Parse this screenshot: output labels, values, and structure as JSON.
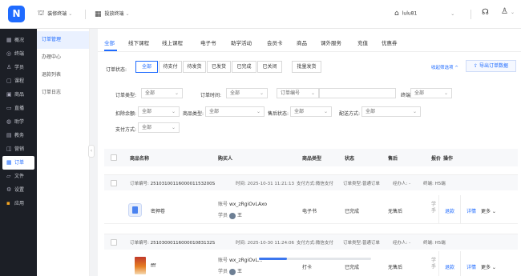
{
  "topbar": {
    "logo_letter": "N",
    "terminal_label": "装修终端",
    "terminal_icon": "shirt-icon",
    "admin_label": "投放终端",
    "admin_icon": "grid-icon",
    "shop_label": "lulu81",
    "shop_icon": "bank-icon",
    "help_icon": "headset-icon",
    "user_icon": "user-icon"
  },
  "sidebar": {
    "items": [
      {
        "icon": "grid-icon",
        "glyph": "▦",
        "label": "概况"
      },
      {
        "icon": "terminal-icon",
        "glyph": "◎",
        "label": "终端"
      },
      {
        "icon": "student-icon",
        "glyph": "♙",
        "label": "学员"
      },
      {
        "icon": "course-icon",
        "glyph": "▢",
        "label": "课程"
      },
      {
        "icon": "product-icon",
        "glyph": "▣",
        "label": "商品"
      },
      {
        "icon": "live-icon",
        "glyph": "▭",
        "label": "直播"
      },
      {
        "icon": "study-icon",
        "glyph": "◍",
        "label": "助学"
      },
      {
        "icon": "teacher-icon",
        "glyph": "▤",
        "label": "教务"
      },
      {
        "icon": "marketing-icon",
        "glyph": "◫",
        "label": "营销"
      },
      {
        "icon": "order-icon",
        "glyph": "▦",
        "label": "订单"
      },
      {
        "icon": "file-icon",
        "glyph": "▱",
        "label": "文件"
      },
      {
        "icon": "settings-icon",
        "glyph": "⚙",
        "label": "设置"
      },
      {
        "icon": "apps-icon",
        "glyph": "▪",
        "label": "应用"
      }
    ]
  },
  "subnav": {
    "items": [
      "订单管理",
      "办理中心",
      "退款列表",
      "订单日志"
    ]
  },
  "tabs": [
    "全部",
    "线下课程",
    "线上课程",
    "电子书",
    "助学活动",
    "会员卡",
    "商品",
    "课外服务",
    "充值",
    "优惠券"
  ],
  "status": {
    "label": "订单状态:",
    "options": [
      "全部",
      "待支付",
      "待发货",
      "已发货",
      "已完成",
      "已关闭"
    ],
    "batch_button": "批量发货",
    "collapse_link": "收起筛选项 ^",
    "export_button": "导出订单数据"
  },
  "filters": {
    "order_type": {
      "label": "订单类型:",
      "value": "全部"
    },
    "order_time": {
      "label": "订单时间:",
      "value": "全部"
    },
    "order_no": {
      "label": "订单编号",
      "placeholder": ""
    },
    "terminal": {
      "label": "终端:",
      "value": "全部"
    },
    "deduct_balance": {
      "label": "扣除余额:",
      "value": "全部"
    },
    "product_type": {
      "label": "商品类型:",
      "value": "全部"
    },
    "aftersale_status": {
      "label": "售后状态:",
      "value": "全部"
    },
    "delivery_method": {
      "label": "配送方式:",
      "value": "全部"
    },
    "pay_method": {
      "label": "支付方式:",
      "value": "全部"
    }
  },
  "table": {
    "headers": [
      "商品名称",
      "购买人",
      "商品类型",
      "状态",
      "售后",
      "报价",
      "操作"
    ]
  },
  "orders": [
    {
      "head": {
        "order_no_label": "订单编号:",
        "order_no": "2510310011600001153200S",
        "time_label": "时间:",
        "time": "2025-10-31 11:21:13",
        "pay_label": "支付方式:",
        "pay": "微信支付",
        "type_label": "订单类型:",
        "type": "普通订单",
        "handler_label": "经办人:",
        "handler": "-",
        "terminal_label": "终端:",
        "terminal": "H5端"
      },
      "product_name": "密押卷",
      "buyer_account_label": "账号",
      "buyer_account": "wx_zRgiOvLAxo",
      "buyer_student_label": "学员",
      "buyer_student": "王",
      "product_type": "电子书",
      "status": "已完成",
      "aftersale": "无售后",
      "price": "学\n手",
      "action_refund": "退款",
      "action_detail": "详情",
      "action_more": "更多 ⌄"
    },
    {
      "head": {
        "order_no_label": "订单编号:",
        "order_no": "2510300011600001083132S",
        "time_label": "时间:",
        "time": "2025-10-30 11:24:06",
        "pay_label": "支付方式:",
        "pay": "微信支付",
        "type_label": "订单类型:",
        "type": "普通订单",
        "handler_label": "经办人:",
        "handler": "-",
        "terminal_label": "终端:",
        "terminal": "H5端"
      },
      "product_name": "fff",
      "buyer_account_label": "账号",
      "buyer_account": "wx_zRgiOvL...",
      "buyer_student_label": "学员",
      "buyer_student": "王",
      "product_type": "打卡",
      "status": "已完成",
      "aftersale": "无售后",
      "price": "学\n手",
      "action_refund": "退款",
      "action_detail": "详情",
      "action_more": "更多 ⌄"
    }
  ],
  "loading": {
    "progress": 0.25
  },
  "colors": {
    "accent": "#1f6bff",
    "sidebar_bg": "#1c1f26"
  }
}
